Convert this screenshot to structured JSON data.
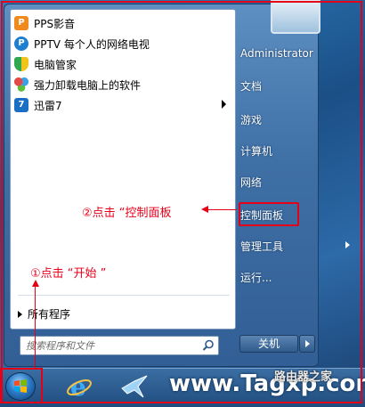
{
  "programs": [
    {
      "label": "PPS影音",
      "icon": "pps-icon",
      "color": "#f08a1c",
      "has_submenu": false
    },
    {
      "label": "PPTV 每个人的网络电视",
      "icon": "pptv-icon",
      "color": "#1e7fd0",
      "has_submenu": false
    },
    {
      "label": "电脑管家",
      "icon": "shield-icon",
      "color": "#2fa84f",
      "has_submenu": false
    },
    {
      "label": "强力卸载电脑上的软件",
      "icon": "uninstall-icon",
      "color": "#8a4ec2",
      "has_submenu": false
    },
    {
      "label": "迅雷7",
      "icon": "thunder-icon",
      "color": "#1a6fc4",
      "has_submenu": true
    }
  ],
  "all_programs_label": "所有程序",
  "search": {
    "placeholder": "搜索程序和文件"
  },
  "right_items": [
    {
      "label": "Administrator",
      "has_submenu": false
    },
    {
      "label": "文档",
      "has_submenu": false
    },
    {
      "label": "游戏",
      "has_submenu": false
    },
    {
      "label": "计算机",
      "has_submenu": false
    },
    {
      "label": "网络",
      "has_submenu": false
    },
    {
      "label": "控制面板",
      "has_submenu": false,
      "highlighted": true
    },
    {
      "label": "管理工具",
      "has_submenu": true
    },
    {
      "label": "运行...",
      "has_submenu": false
    }
  ],
  "shutdown_label": "关机",
  "annotations": {
    "step2": "②点击 “控制面板",
    "step1": "①点击 “开始 ”"
  },
  "watermark": {
    "text": "www.Tagxp.com",
    "brand": "路由器之家"
  },
  "colors": {
    "annotation": "#e5001a",
    "menu": "#3e6fa5"
  }
}
